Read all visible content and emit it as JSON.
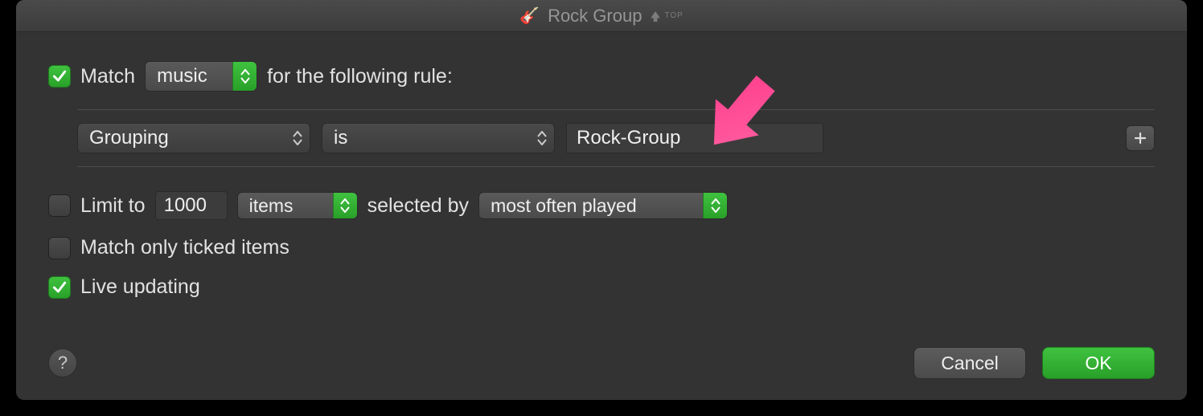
{
  "title": "Rock Group",
  "top_badge": "TOP",
  "match": {
    "checkbox_checked": true,
    "prefix_label": "Match",
    "media_type": "music",
    "suffix_label": "for the following rule:"
  },
  "rule": {
    "field": "Grouping",
    "operator": "is",
    "value": "Rock-Group"
  },
  "limit": {
    "checked": false,
    "label": "Limit to",
    "count": "1000",
    "unit": "items",
    "selected_by_label": "selected by",
    "order": "most often played"
  },
  "match_only_ticked": {
    "checked": false,
    "label": "Match only ticked items"
  },
  "live_updating": {
    "checked": true,
    "label": "Live updating"
  },
  "footer": {
    "help": "?",
    "cancel": "Cancel",
    "ok": "OK"
  }
}
